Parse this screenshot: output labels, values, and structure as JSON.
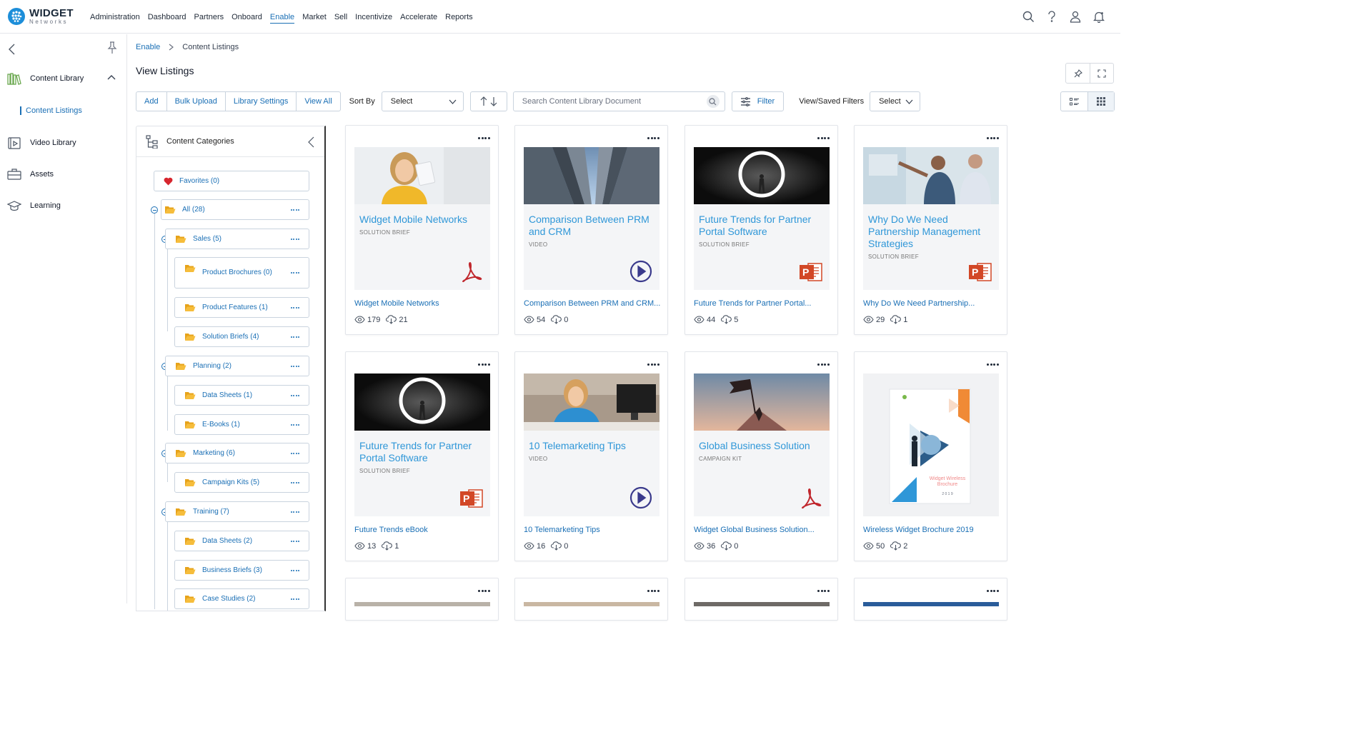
{
  "brand": {
    "name": "WIDGET",
    "sub": "Networks",
    "accent": "#1a6fb5",
    "logo_color": "#1d8ed9"
  },
  "nav": [
    "Administration",
    "Dashboard",
    "Partners",
    "Onboard",
    "Enable",
    "Market",
    "Sell",
    "Incentivize",
    "Accelerate",
    "Reports"
  ],
  "nav_active": "Enable",
  "top_icons": [
    "search-icon",
    "help-icon",
    "user-icon",
    "bell-icon"
  ],
  "sidebar": {
    "items": [
      {
        "label": "Content Library",
        "icon": "books-icon",
        "expanded": true
      },
      {
        "label": "Video Library",
        "icon": "video-icon"
      },
      {
        "label": "Assets",
        "icon": "briefcase-icon"
      },
      {
        "label": "Learning",
        "icon": "graduation-cap-icon"
      }
    ],
    "sub_item": "Content Listings"
  },
  "breadcrumb": {
    "root": "Enable",
    "current": "Content Listings"
  },
  "page_title": "View Listings",
  "toolbar": {
    "buttons": [
      "Add",
      "Bulk Upload",
      "Library Settings",
      "View All"
    ],
    "sort_label": "Sort By",
    "sort_value": "Select",
    "search_placeholder": "Search Content Library Document",
    "filter_label": "Filter",
    "saved_filters_label": "View/Saved Filters",
    "saved_filters_value": "Select"
  },
  "categories": {
    "title": "Content Categories",
    "items": [
      "Favorites (0)",
      "All (28)",
      "Sales (5)",
      "Product Brochures (0)",
      "Product Features (1)",
      "Solution Briefs (4)",
      "Planning (2)",
      "Data Sheets (1)",
      "E-Books (1)",
      "Marketing (6)",
      "Campaign Kits (5)",
      "Training (7)",
      "Data Sheets (2)",
      "Business Briefs (3)",
      "Case Studies (2)"
    ]
  },
  "cards": [
    {
      "thumb_title": "Widget Mobile Networks",
      "thumb_type": "SOLUTION BRIEF",
      "title": "Widget Mobile Networks",
      "views": "179",
      "downloads": "21",
      "file": "pdf"
    },
    {
      "thumb_title": "Comparison Between PRM and CRM",
      "thumb_type": "VIDEO",
      "title": "Comparison Between PRM and CRM...",
      "views": "54",
      "downloads": "0",
      "file": "video"
    },
    {
      "thumb_title": "Future Trends for Partner Portal Software",
      "thumb_type": "SOLUTION BRIEF",
      "title": "Future Trends for Partner Portal...",
      "views": "44",
      "downloads": "5",
      "file": "ppt"
    },
    {
      "thumb_title": "Why Do We Need Partnership Management Strategies",
      "thumb_type": "SOLUTION BRIEF",
      "title": "Why Do We Need Partnership...",
      "views": "29",
      "downloads": "1",
      "file": "ppt"
    },
    {
      "thumb_title": "Future Trends for Partner Portal Software",
      "thumb_type": "SOLUTION BRIEF",
      "title": "Future Trends eBook",
      "views": "13",
      "downloads": "1",
      "file": "ppt"
    },
    {
      "thumb_title": "10 Telemarketing Tips",
      "thumb_type": "VIDEO",
      "title": "10 Telemarketing Tips",
      "views": "16",
      "downloads": "0",
      "file": "video"
    },
    {
      "thumb_title": "Global Business Solution",
      "thumb_type": "CAMPAIGN KIT",
      "title": "Widget Global Business Solution...",
      "views": "36",
      "downloads": "0",
      "file": "pdf"
    },
    {
      "thumb_title": "",
      "thumb_type": "",
      "title": "Wireless Widget Brochure 2019",
      "views": "50",
      "downloads": "2",
      "file": "brochure",
      "brochure_text": "Widget Wireless Brochure",
      "brochure_year": "2 0 1 9"
    }
  ]
}
